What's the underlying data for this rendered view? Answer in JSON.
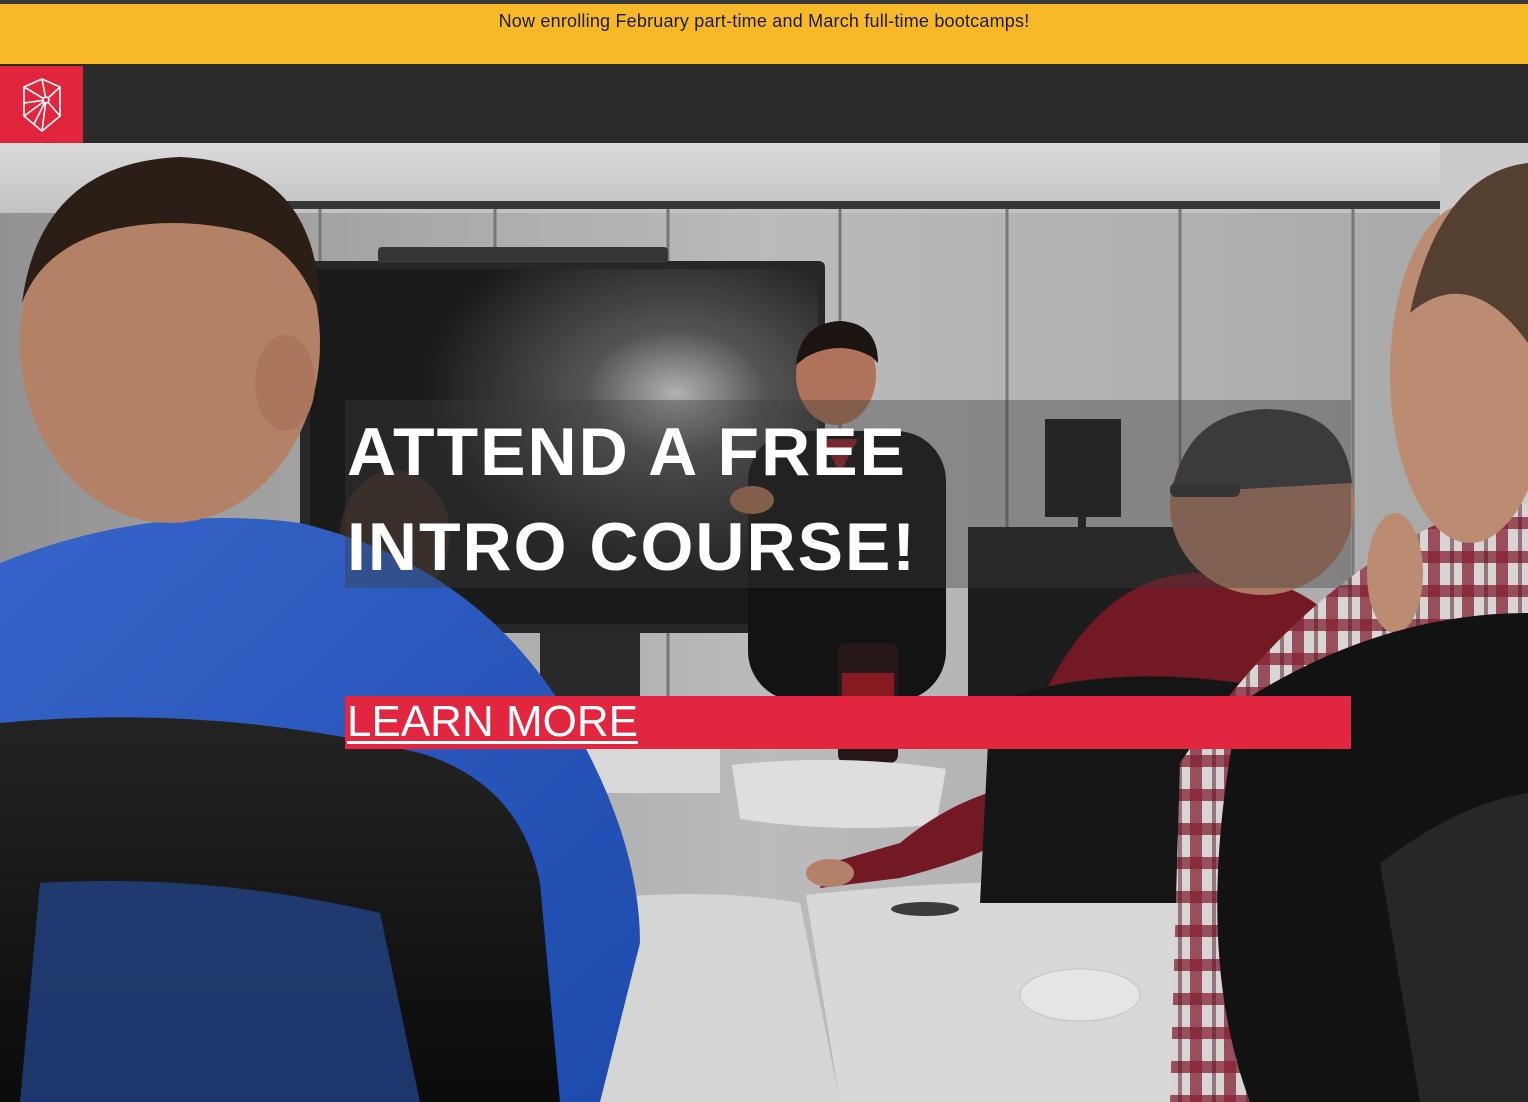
{
  "announcement": {
    "text": "Now enrolling February part-time and March full-time bootcamps!"
  },
  "navbar": {
    "logo_icon": "geometric-hexagon-logo-icon"
  },
  "hero": {
    "headline_line1": "ATTEND A FREE",
    "headline_line2": "INTRO COURSE!",
    "cta_label": "LEARN MORE",
    "background": "classroom-photo"
  },
  "colors": {
    "announcement_bg": "#f7b928",
    "navbar_bg": "#2b2b2b",
    "brand_red": "#e0253d",
    "cta_bg": "#e3263f"
  }
}
